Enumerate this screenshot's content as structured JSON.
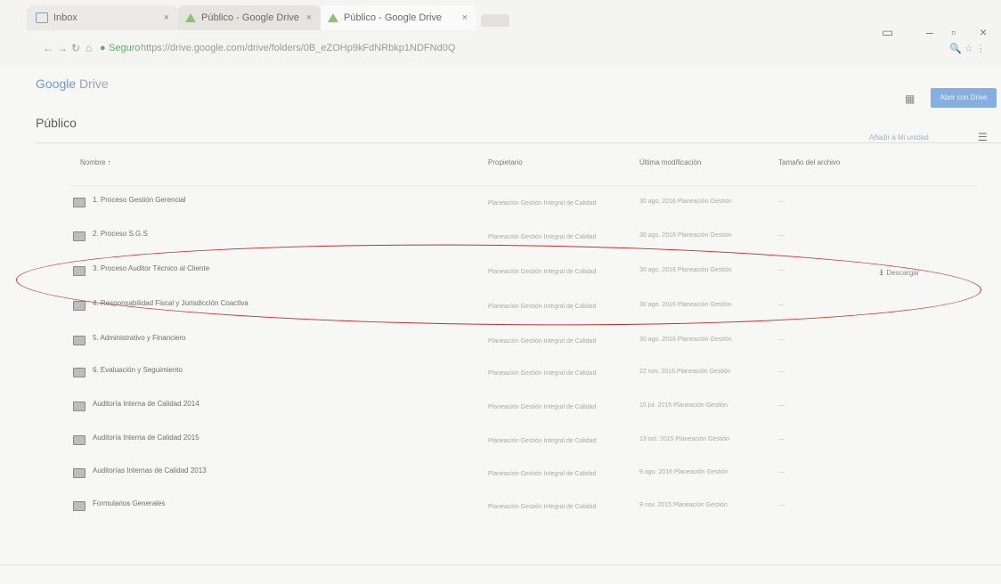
{
  "browser": {
    "tabs": [
      {
        "label": "Inbox"
      },
      {
        "label": "Público - Google Drive"
      },
      {
        "label": "Público - Google Drive"
      }
    ],
    "address": {
      "secure_label": "Seguro",
      "url": "https://drive.google.com/drive/folders/0B_eZOHp9kFdNRbkp1NDFNd0Q"
    },
    "window_controls": [
      "–",
      "▫",
      "×"
    ]
  },
  "drive": {
    "logo_google": "Google",
    "logo_drive": "Drive",
    "open_button": "Abrir con Drive",
    "folder_title": "Público",
    "sort_link": "Añadir a Mi unidad",
    "columns": {
      "name": "Nombre ↑",
      "owner": "Propietario",
      "modified": "Última modificación",
      "size": "Tamaño del archivo"
    },
    "rows": [
      {
        "name": "1. Proceso Gestión Gerencial",
        "owner": "Planeación Gestión Integral de Calidad",
        "modified": "30 ago. 2016 Planeación Gestión",
        "size": "—"
      },
      {
        "name": "2. Proceso S.G.S",
        "owner": "Planeación Gestión Integral de Calidad",
        "modified": "30 ago. 2016 Planeación Gestión",
        "size": "—"
      },
      {
        "name": "3. Proceso Auditor Técnico al Cliente",
        "owner": "Planeación Gestión Integral de Calidad",
        "modified": "30 ago. 2016 Planeación Gestión",
        "size": "—",
        "download": "Descargar"
      },
      {
        "name": "4. Responsabilidad Fiscal y Jurisdicción Coactiva",
        "owner": "Planeación Gestión Integral de Calidad",
        "modified": "30 ago. 2016 Planeación Gestión",
        "size": "—"
      },
      {
        "name": "5. Administrativo y Financiero",
        "owner": "Planeación Gestión Integral de Calidad",
        "modified": "30 ago. 2016 Planeación Gestión",
        "size": "—"
      },
      {
        "name": "6. Evaluación y Seguimiento",
        "owner": "Planeación Gestión Integral de Calidad",
        "modified": "22 nov. 2016 Planeación Gestión",
        "size": "—"
      },
      {
        "name": "Auditoría Interna de Calidad 2014",
        "owner": "Planeación Gestión Integral de Calidad",
        "modified": "15 jul. 2015 Planeación Gestión",
        "size": "—"
      },
      {
        "name": "Auditoría Interna de Calidad 2015",
        "owner": "Planeación Gestión Integral de Calidad",
        "modified": "13 oct. 2015 Planeación Gestión",
        "size": "—"
      },
      {
        "name": "Auditorías Internas de Calidad 2013",
        "owner": "Planeación Gestión Integral de Calidad",
        "modified": "9 ago. 2016 Planeación Gestión",
        "size": "—"
      },
      {
        "name": "Formularios Generales",
        "owner": "Planeación Gestión Integral de Calidad",
        "modified": "9 nov. 2015 Planeación Gestión",
        "size": "—"
      }
    ]
  }
}
